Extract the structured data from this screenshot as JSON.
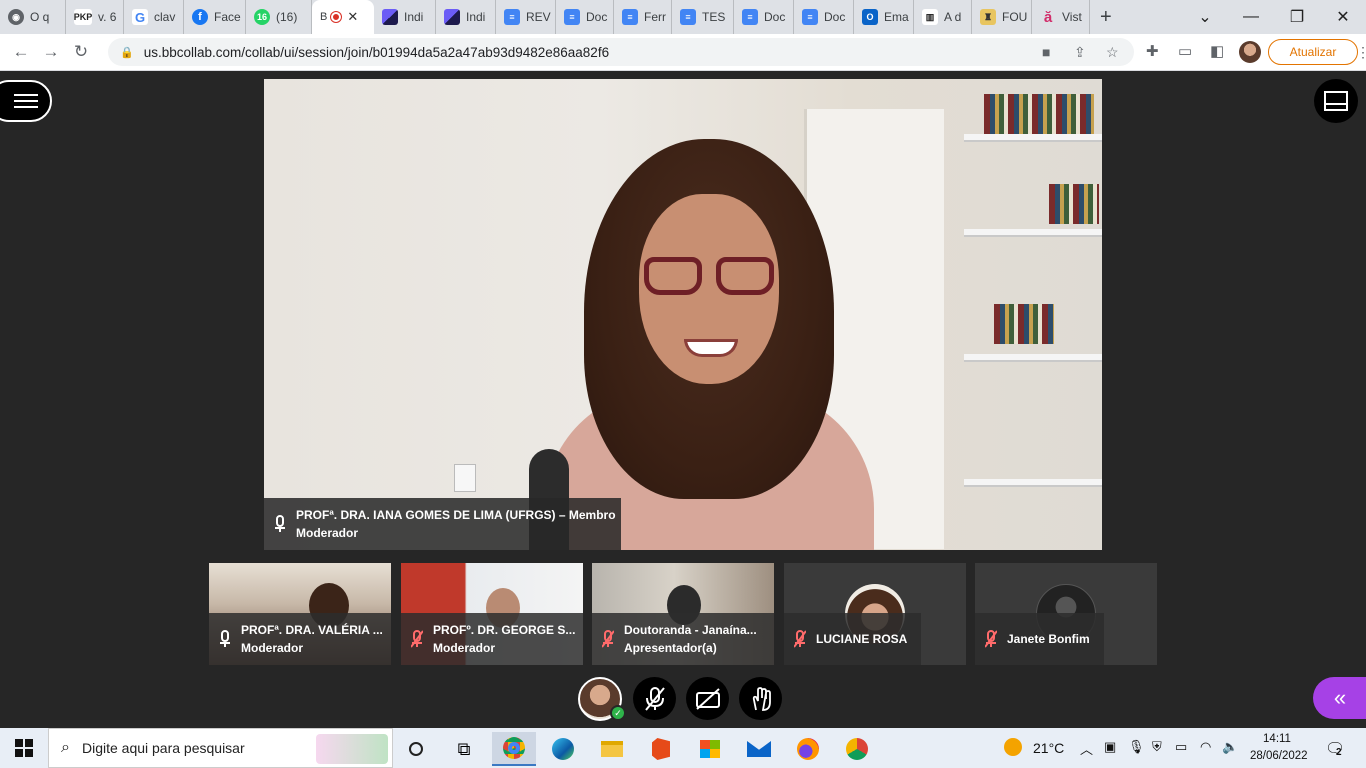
{
  "browser": {
    "tabs": [
      {
        "label": "O q",
        "icon": "chrome-icon",
        "color": "#5f6368"
      },
      {
        "label": "v. 6",
        "icon": "pkp-icon",
        "color": "#222"
      },
      {
        "label": "clav",
        "icon": "google-icon",
        "color": "#4285f4"
      },
      {
        "label": "Face",
        "icon": "facebook-icon",
        "color": "#1877f2"
      },
      {
        "label": "(16)",
        "icon": "whatsapp-icon",
        "color": "#25d366"
      },
      {
        "label": "B",
        "icon": "blackboard-icon",
        "color": "#333",
        "active": true
      },
      {
        "label": "Indi",
        "icon": "indigo-icon",
        "color": "#3a2f8f"
      },
      {
        "label": "Indi",
        "icon": "indigo-icon",
        "color": "#3a2f8f"
      },
      {
        "label": "REV",
        "icon": "docs-icon",
        "color": "#4285f4"
      },
      {
        "label": "Doc",
        "icon": "docs-icon",
        "color": "#4285f4"
      },
      {
        "label": "Ferr",
        "icon": "docs-icon",
        "color": "#4285f4"
      },
      {
        "label": "TES",
        "icon": "docs-icon",
        "color": "#4285f4"
      },
      {
        "label": "Doc",
        "icon": "docs-icon",
        "color": "#4285f4"
      },
      {
        "label": "Doc",
        "icon": "docs-icon",
        "color": "#4285f4"
      },
      {
        "label": "Ema",
        "icon": "outlook-icon",
        "color": "#0a64c8"
      },
      {
        "label": "A d",
        "icon": "book-icon",
        "color": "#333"
      },
      {
        "label": "FOU",
        "icon": "crest-icon",
        "color": "#8a6d1f"
      },
      {
        "label": "Vist",
        "icon": "a-icon",
        "color": "#d12d6a"
      }
    ],
    "new_tab": "+",
    "url": "us.bbcollab.com/collab/ui/session/join/b01994da5a2a47ab93d9482e86aa82f6",
    "update_label": "Atualizar"
  },
  "session": {
    "main_speaker": {
      "name_line1": "PROFª. DRA. IANA GOMES DE LIMA (UFRGS) – Membro",
      "name_line2": "Moderador"
    },
    "participants": [
      {
        "name": "PROFª. DRA. VALÉRIA ...",
        "role": "Moderador",
        "muted": false
      },
      {
        "name": "PROFº. DR. GEORGE S...",
        "role": "Moderador",
        "muted": true
      },
      {
        "name": "Doutoranda - Janaína...",
        "role": "Apresentador(a)",
        "muted": true
      },
      {
        "name": "LUCIANE ROSA",
        "role": "",
        "muted": true
      },
      {
        "name": "Janete Bonfim",
        "role": "",
        "muted": true
      }
    ]
  },
  "taskbar": {
    "search_placeholder": "Digite aqui para pesquisar",
    "weather": "21°C",
    "time": "14:11",
    "date": "28/06/2022",
    "notifications": "2"
  }
}
